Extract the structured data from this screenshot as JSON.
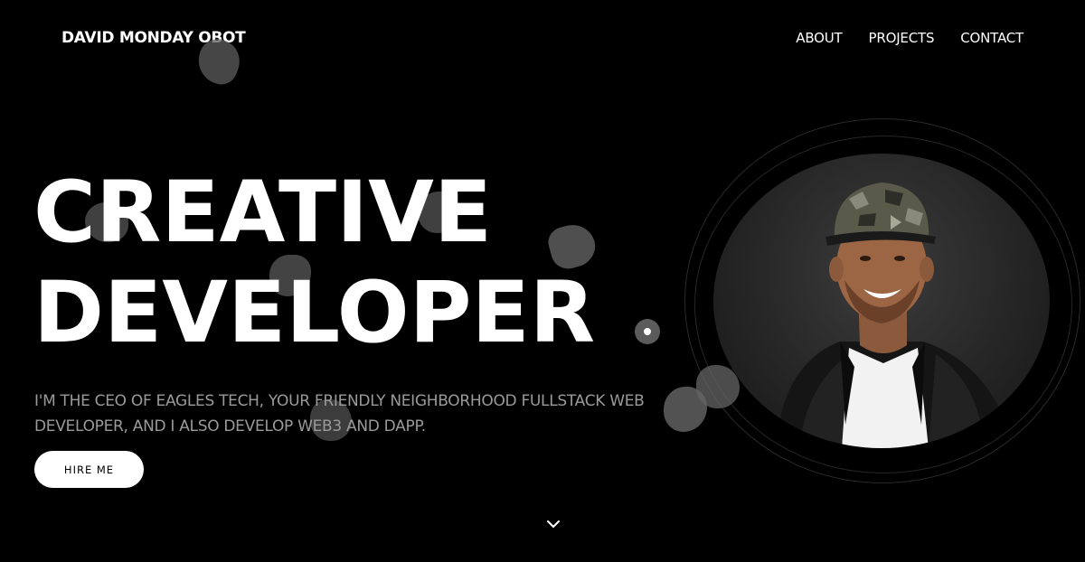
{
  "header": {
    "logo": "DAVID MONDAY OBOT",
    "nav": [
      "ABOUT",
      "PROJECTS",
      "CONTACT"
    ]
  },
  "hero": {
    "title_line1": "CREATIVE",
    "title_line2": "DEVELOPER",
    "subtitle": "I'M THE CEO OF EAGLES TECH, YOUR FRIENDLY NEIGHBORHOOD FULLSTACK WEB DEVELOPER, AND I ALSO DEVELOP WEB3 AND DAPP.",
    "cta_label": "HIRE ME"
  },
  "icons": {
    "scroll": "chevron-down-icon"
  },
  "colors": {
    "background": "#000000",
    "text": "#ffffff",
    "subtitle": "#9a9a9a",
    "button_bg": "#ffffff",
    "button_text": "#000000"
  }
}
